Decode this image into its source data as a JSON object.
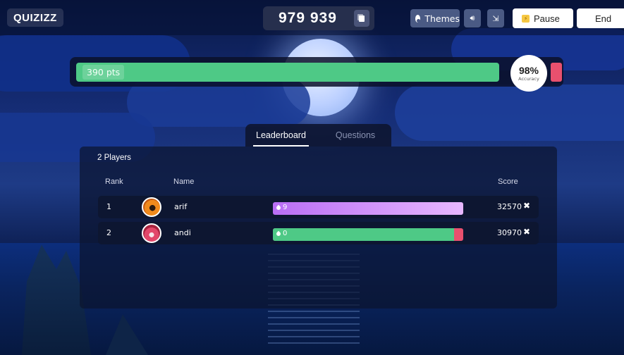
{
  "header": {
    "logo": "QUIZIZZ",
    "game_code": "979 939",
    "themes_label": "Themes",
    "pause_label": "Pause",
    "end_label": "End"
  },
  "progress": {
    "points": "390 pts",
    "accuracy": "98%",
    "accuracy_label": "Accuracy",
    "correct_fraction": 0.98,
    "colors": {
      "correct": "#4ec986",
      "incorrect": "#e8506e"
    }
  },
  "tabs": [
    {
      "label": "Leaderboard",
      "active": true
    },
    {
      "label": "Questions",
      "active": false
    }
  ],
  "leaderboard": {
    "players_count": "2 Players",
    "columns": {
      "rank": "Rank",
      "name": "Name",
      "score": "Score"
    },
    "rows": [
      {
        "rank": "1",
        "name": "arif",
        "streak": "9",
        "score": "32570",
        "remove": "✖",
        "bar_color": "#b96ef5",
        "bar_color_end": "#e7b7ff",
        "correct_fraction": 1.0
      },
      {
        "rank": "2",
        "name": "andi",
        "streak": "0",
        "score": "30970",
        "remove": "✖",
        "bar_color": "#4ec986",
        "bar_color_end": "#4ec986",
        "correct_fraction": 0.95
      }
    ]
  }
}
